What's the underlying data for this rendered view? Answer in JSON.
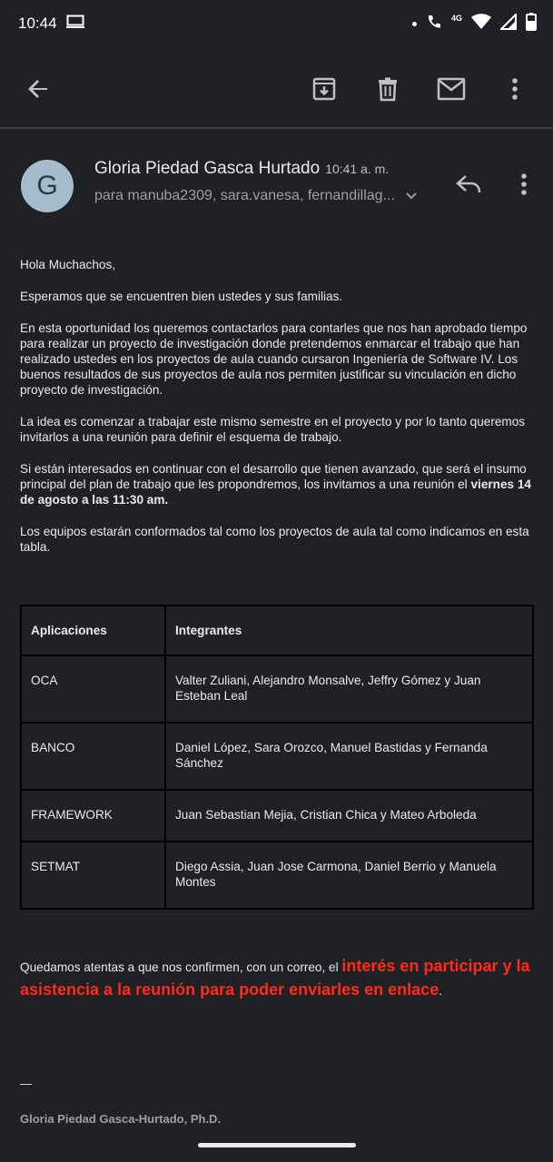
{
  "status_bar": {
    "time": "10:44",
    "network_label": "4G",
    "icons": [
      "screen-cast-icon",
      "notification-dot-icon",
      "wifi-calling-icon",
      "wifi-icon",
      "signal-icon",
      "battery-icon"
    ]
  },
  "toolbar": {
    "icons": [
      "back-arrow-icon",
      "archive-icon",
      "delete-icon",
      "mark-unread-icon",
      "more-vert-icon"
    ]
  },
  "email": {
    "avatar_letter": "G",
    "sender": "Gloria Piedad Gasca Hurtado",
    "time": "10:41 a. m.",
    "recipients": "para manuba2309, sara.vanesa, fernandillag...",
    "body": {
      "greeting": "Hola Muchachos,",
      "p1": "Esperamos que se encuentren bien ustedes y sus familias.",
      "p2": "En esta oportunidad los queremos contactarlos para contarles que nos han aprobado tiempo para realizar un proyecto de investigación donde pretendemos enmarcar el trabajo que han realizado ustedes en los proyectos de aula cuando cursaron Ingeniería de Software IV. Los buenos resultados de sus proyectos de aula nos permiten justificar su vinculación en dicho proyecto de investigación.",
      "p3": "La idea es comenzar a trabajar este mismo semestre en el proyecto y por lo tanto queremos invitarlos a una reunión para definir el esquema de trabajo.",
      "p4_text": "Si están interesados en continuar con el desarrollo que tienen avanzado, que será el insumo principal del plan de trabajo que les propondremos, los invitamos a una reunión el ",
      "p4_bold": "viernes 14 de agosto a las 11:30 am.",
      "p5": "Los equipos estarán conformados tal como los proyectos de aula tal como indicamos en esta tabla."
    },
    "table": {
      "headers": [
        "Aplicaciones",
        "Integrantes"
      ],
      "rows": [
        [
          "OCA",
          "Valter Zuliani, Alejandro Monsalve, Jeffry Gómez y Juan Esteban Leal"
        ],
        [
          "BANCO",
          "Daniel López, Sara Orozco, Manuel Bastidas y Fernanda Sánchez"
        ],
        [
          "FRAMEWORK",
          "Juan Sebastian Mejia, Cristian Chica y Mateo Arboleda"
        ],
        [
          "SETMAT",
          "Diego Assia, Juan Jose Carmona, Daniel Berrio y Manuela Montes"
        ]
      ]
    },
    "closing_text": "Quedamos atentas a que nos confirmen, con un correo, el ",
    "closing_red": "interés en participar y la asistencia a la reunión para poder enviarles en enlace",
    "closing_end": ".",
    "signature_dash": "—",
    "signature_name": "Gloria Piedad Gasca-Hurtado, Ph.D."
  },
  "colors": {
    "background": "#202124",
    "highlight_red": "#ff2b1a",
    "avatar_bg": "#a4bccb"
  }
}
